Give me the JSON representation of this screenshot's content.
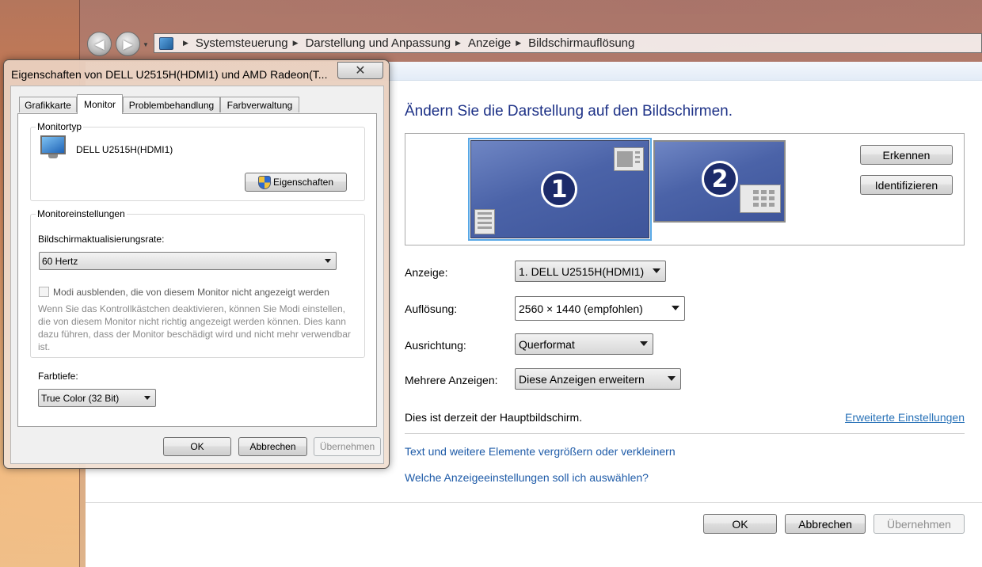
{
  "main": {
    "breadcrumb": [
      "Systemsteuerung",
      "Darstellung und Anpassung",
      "Anzeige",
      "Bildschirmauflösung"
    ],
    "heading": "Ändern Sie die Darstellung auf den Bildschirmen.",
    "monitors": [
      {
        "number": "1",
        "selected": true
      },
      {
        "number": "2",
        "selected": false
      }
    ],
    "detect_label": "Erkennen",
    "identify_label": "Identifizieren",
    "fields": {
      "display": {
        "label": "Anzeige:",
        "value": "1. DELL U2515H(HDMI1)"
      },
      "resolution": {
        "label": "Auflösung:",
        "value": "2560 × 1440 (empfohlen)"
      },
      "orientation": {
        "label": "Ausrichtung:",
        "value": "Querformat"
      },
      "multiple": {
        "label": "Mehrere Anzeigen:",
        "value": "Diese Anzeigen erweitern"
      }
    },
    "status_text": "Dies ist derzeit der Hauptbildschirm.",
    "advanced_link": "Erweiterte Einstellungen",
    "links": [
      "Text und weitere Elemente vergrößern oder verkleinern",
      "Welche Anzeigeeinstellungen soll ich auswählen?"
    ],
    "ok_label": "OK",
    "cancel_label": "Abbrechen",
    "apply_label": "Übernehmen"
  },
  "dialog": {
    "title": "Eigenschaften von DELL U2515H(HDMI1) und AMD Radeon(T...",
    "close_glyph": "✕",
    "tabs": [
      "Grafikkarte",
      "Monitor",
      "Problembehandlung",
      "Farbverwaltung"
    ],
    "active_tab": "Monitor",
    "monitor_type": {
      "group_label": "Monitortyp",
      "name": "DELL U2515H(HDMI1)",
      "properties_label": "Eigenschaften"
    },
    "monitor_settings": {
      "group_label": "Monitoreinstellungen",
      "refresh_label": "Bildschirmaktualisierungsrate:",
      "refresh_value": "60 Hertz",
      "hide_modes_label": "Modi ausblenden, die von diesem Monitor nicht angezeigt werden",
      "hide_modes_checked": false,
      "warning": "Wenn Sie das Kontrollkästchen deaktivieren, können Sie Modi einstellen, die von diesem Monitor nicht richtig angezeigt werden können. Dies kann dazu führen, dass der Monitor beschädigt wird und nicht mehr verwendbar ist."
    },
    "color_depth": {
      "label": "Farbtiefe:",
      "value": "True Color (32 Bit)"
    },
    "ok_label": "OK",
    "cancel_label": "Abbrechen",
    "apply_label": "Übernehmen"
  },
  "colors": {
    "accent": "#1e3287",
    "link": "#1e5ba8",
    "monitor_blue": "#4b63a8",
    "selection_outline": "#58a8e6"
  },
  "icons": [
    "back-arrow-icon",
    "forward-arrow-icon",
    "control-panel-icon",
    "monitor-icon",
    "uac-shield-icon",
    "close-icon",
    "chevron-down-icon"
  ]
}
